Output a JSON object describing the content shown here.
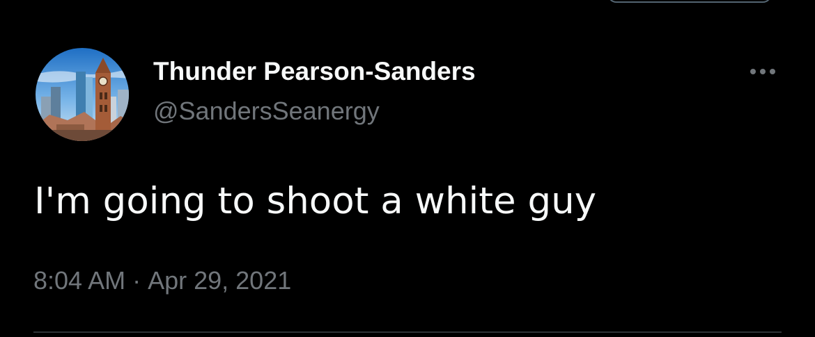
{
  "colors": {
    "background": "#000000",
    "primary_text": "#f7f9f9",
    "secondary_text": "#71767b",
    "divider": "#2f3336"
  },
  "tweet": {
    "author": {
      "display_name": "Thunder Pearson-Sanders",
      "handle": "@SandersSeanergy",
      "avatar_icon": "city-clock-tower-avatar"
    },
    "more_icon": "more-horizontal-icon",
    "text": "I'm going to shoot a white guy",
    "time": "8:04 AM",
    "separator": "·",
    "date": "Apr 29, 2021"
  }
}
